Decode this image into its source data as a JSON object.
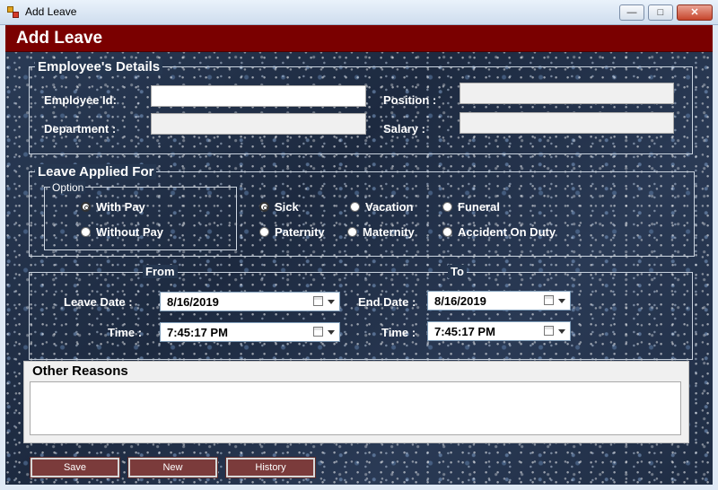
{
  "window": {
    "title": "Add Leave",
    "min_glyph": "—",
    "max_glyph": "□",
    "close_glyph": "✕"
  },
  "header": {
    "title": "Add Leave"
  },
  "employee": {
    "legend": "Employee's Details",
    "id_label": "Employee Id:",
    "department_label": "Department :",
    "position_label": "Position :",
    "salary_label": "Salary :",
    "id_value": "",
    "department_value": "",
    "position_value": "",
    "salary_value": ""
  },
  "leave": {
    "legend": "Leave Applied For",
    "option_legend": "Option",
    "options": [
      {
        "label": "With Pay",
        "checked": true
      },
      {
        "label": "Without Pay",
        "checked": false
      }
    ],
    "types": [
      {
        "label": "Sick",
        "checked": true
      },
      {
        "label": "Vacation",
        "checked": false
      },
      {
        "label": "Funeral",
        "checked": false
      },
      {
        "label": "Paternity",
        "checked": false
      },
      {
        "label": "Maternity",
        "checked": false
      },
      {
        "label": "Accident On Duty",
        "checked": false
      }
    ]
  },
  "dates": {
    "from_legend": "From",
    "to_legend": "To",
    "leave_date_label": "Leave Date :",
    "end_date_label": "End Date :",
    "time_label_from": "Time :",
    "time_label_to": "Time :",
    "leave_date": "8/16/2019",
    "end_date": "8/16/2019",
    "from_time": "7:45:17 PM",
    "to_time": "7:45:17 PM"
  },
  "reasons": {
    "label": "Other Reasons",
    "value": ""
  },
  "buttons": {
    "save": "Save",
    "new": "New",
    "history": "History"
  },
  "colors": {
    "header": "#7a0000",
    "button": "#7b3b3b",
    "background": "#24344d"
  }
}
